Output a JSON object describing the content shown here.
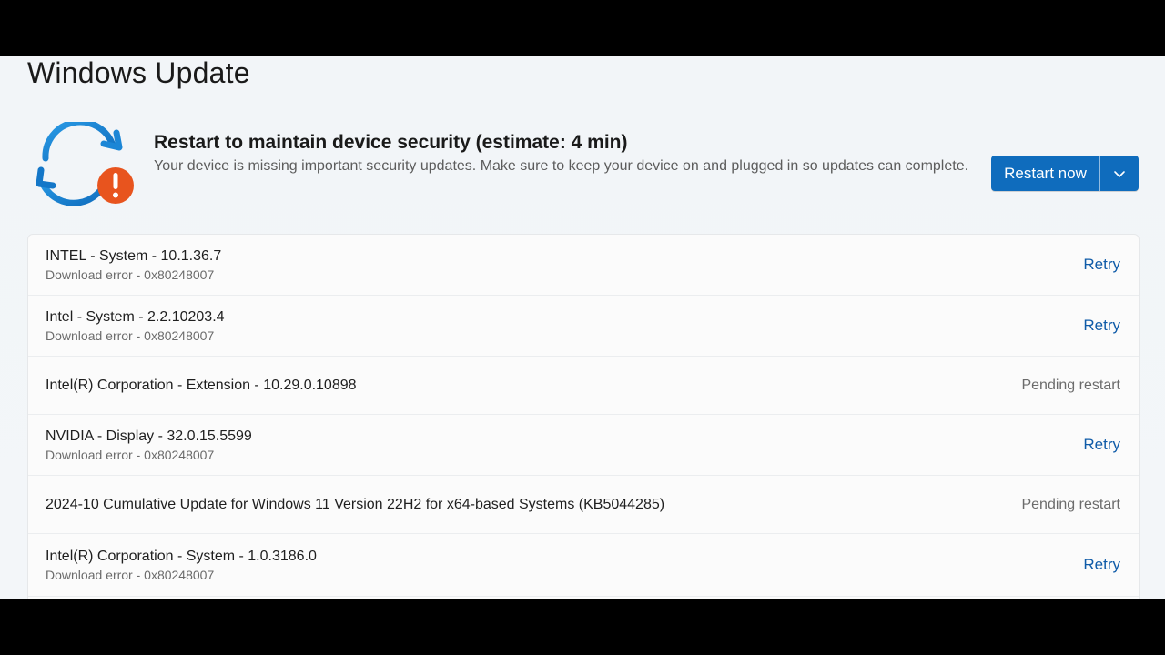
{
  "page": {
    "title": "Windows Update"
  },
  "banner": {
    "title": "Restart to maintain device security (estimate: 4 min)",
    "description": "Your device is missing important security updates. Make sure to keep your device on and plugged in so updates can complete.",
    "primary_button": "Restart now",
    "icon": "sync-alert-icon",
    "accent_color": "#0f6cbd",
    "alert_color": "#e8541e"
  },
  "updates": [
    {
      "name": "INTEL - System - 10.1.36.7",
      "status": "Download error - 0x80248007",
      "action": "Retry"
    },
    {
      "name": "Intel - System - 2.2.10203.4",
      "status": "Download error - 0x80248007",
      "action": "Retry"
    },
    {
      "name": "Intel(R) Corporation - Extension - 10.29.0.10898",
      "status": "",
      "action": "Pending restart"
    },
    {
      "name": "NVIDIA - Display - 32.0.15.5599",
      "status": "Download error - 0x80248007",
      "action": "Retry"
    },
    {
      "name": "2024-10 Cumulative Update for Windows 11 Version 22H2 for x64-based Systems (KB5044285)",
      "status": "",
      "action": "Pending restart"
    },
    {
      "name": "Intel(R) Corporation - System - 1.0.3186.0",
      "status": "Download error - 0x80248007",
      "action": "Retry"
    }
  ]
}
